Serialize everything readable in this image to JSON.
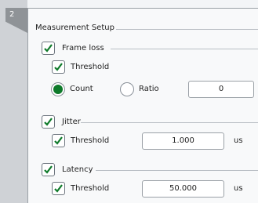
{
  "step": {
    "number": "2"
  },
  "section": {
    "title": "Measurement Setup"
  },
  "frame_loss": {
    "label": "Frame loss",
    "checked": true,
    "threshold_label": "Threshold",
    "threshold_checked": true,
    "mode_options": [
      {
        "label": "Count",
        "selected": true
      },
      {
        "label": "Ratio",
        "selected": false
      }
    ],
    "value": "0"
  },
  "jitter": {
    "label": "Jitter",
    "checked": true,
    "threshold_label": "Threshold",
    "threshold_checked": true,
    "value": "1.000",
    "unit": "us"
  },
  "latency": {
    "label": "Latency",
    "checked": true,
    "threshold_label": "Threshold",
    "threshold_checked": true,
    "value": "50.000",
    "unit": "us"
  },
  "colors": {
    "check": "#0e7a2a",
    "radio_selected": "#0e7a2a",
    "step_tab": "#8f9397"
  }
}
